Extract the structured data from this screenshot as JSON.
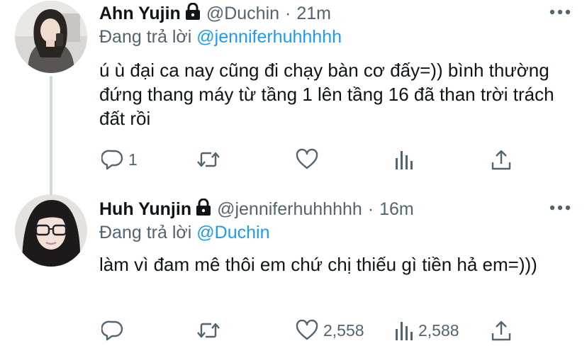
{
  "tweets": [
    {
      "name": "Ahn Yujin",
      "handle": "@Duchin",
      "separator": "·",
      "time": "21m",
      "reply_prefix": "Đang trả lời",
      "reply_to": "@jenniferhuhhhhh",
      "text": "ú ù đại ca nay cũng đi chạy bàn cơ đấy=)) bình thường đứng thang máy từ tầng 1 lên tầng 16 đã than trời trách đất rồi",
      "actions": {
        "reply_count": "1",
        "retweet_count": "",
        "like_count": "",
        "views_count": ""
      },
      "icons": [
        "lock-icon",
        "more-icon",
        "reply-icon",
        "retweet-icon",
        "like-icon",
        "views-icon",
        "share-icon"
      ]
    },
    {
      "name": "Huh Yunjin",
      "handle": "@jenniferhuhhhhh",
      "separator": "·",
      "time": "16m",
      "reply_prefix": "Đang trả lời",
      "reply_to": "@Duchin",
      "text": "làm vì đam mê thôi em chứ chị thiếu gì tiền hả em=)))",
      "actions": {
        "reply_count": "",
        "retweet_count": "",
        "like_count": "2,558",
        "views_count": "2,588"
      },
      "icons": [
        "lock-icon",
        "more-icon",
        "reply-icon",
        "retweet-icon",
        "like-icon",
        "views-icon",
        "share-icon"
      ]
    }
  ],
  "colors": {
    "text": "#0f1419",
    "secondary": "#536471",
    "link": "#1d9bf0",
    "thread_line": "#cfd9de"
  }
}
